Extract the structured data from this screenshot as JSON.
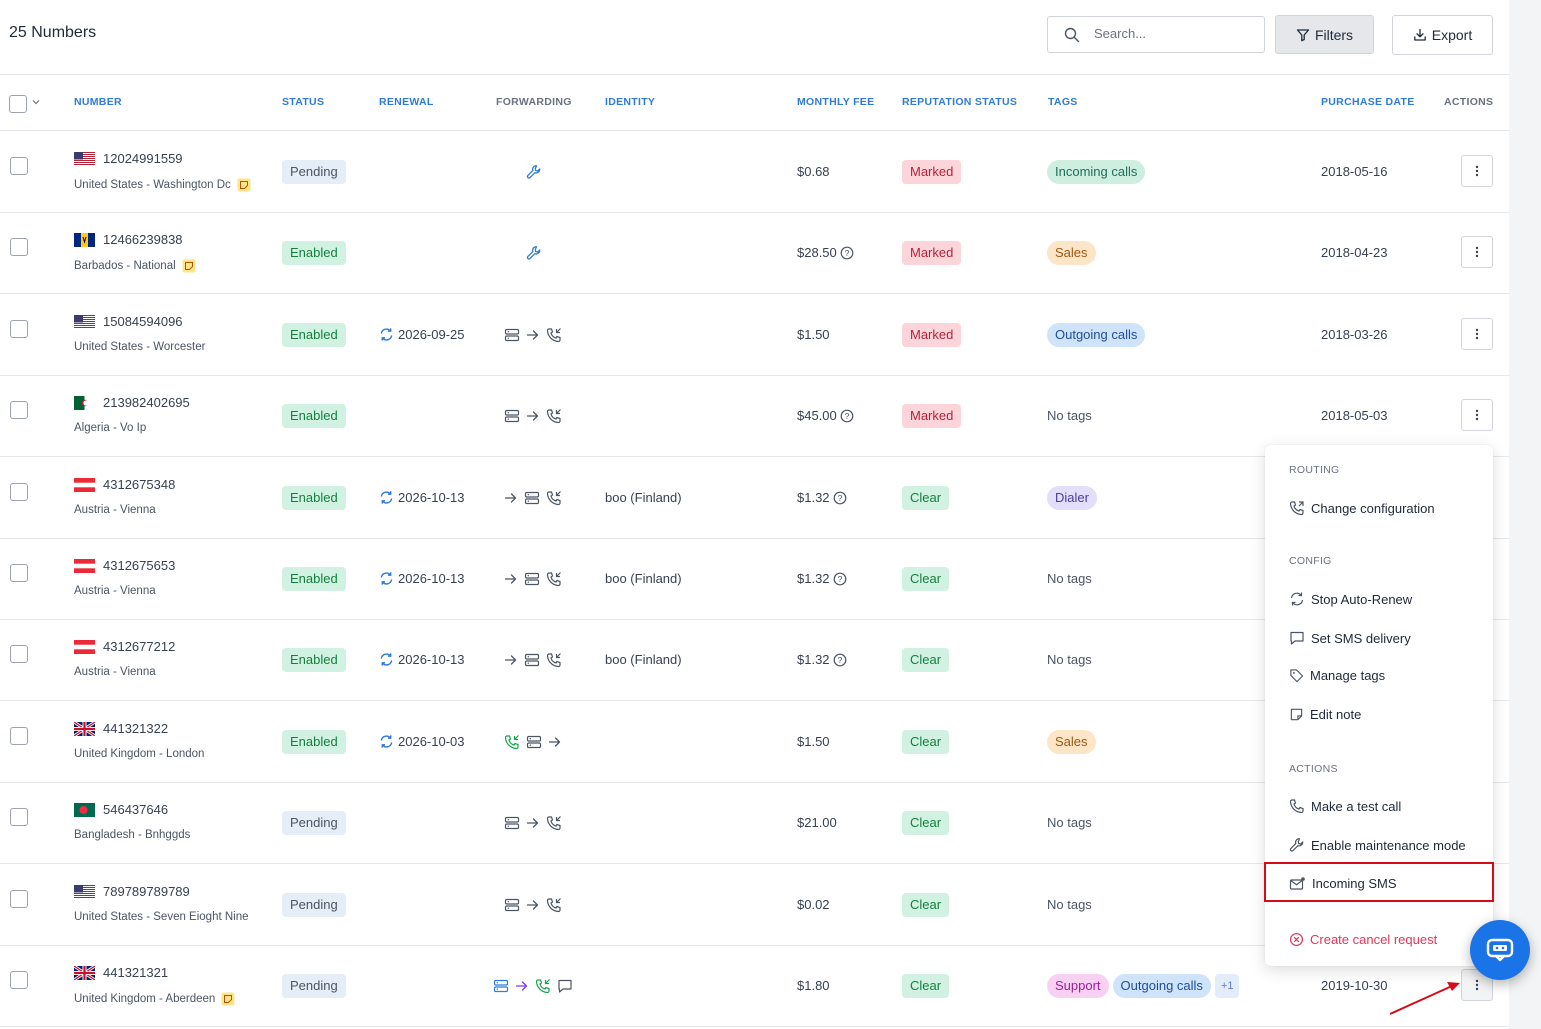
{
  "header": {
    "title": "25 Numbers",
    "search_placeholder": "Search...",
    "filters_label": "Filters",
    "export_label": "Export"
  },
  "columns": {
    "number": "NUMBER",
    "status": "STATUS",
    "renewal": "RENEWAL",
    "forwarding": "FORWARDING",
    "identity": "IDENTITY",
    "monthly_fee": "MONTHLY FEE",
    "reputation": "REPUTATION STATUS",
    "tags": "TAGS",
    "purchase_date": "PURCHASE DATE",
    "actions": "ACTIONS"
  },
  "rows": [
    {
      "flag": "us",
      "number": "12024991559",
      "location": "United States - Washington Dc",
      "note": true,
      "status": "Pending",
      "renewal": "",
      "forwarding": "maintenance",
      "identity": "",
      "fee": "$0.68",
      "fee_info": false,
      "reputation": "Marked",
      "tags": [
        "Incoming calls"
      ],
      "no_tags": "",
      "purchase_date": "2018-05-16"
    },
    {
      "flag": "bb",
      "number": "12466239838",
      "location": "Barbados - National",
      "note": true,
      "status": "Enabled",
      "renewal": "",
      "forwarding": "maintenance",
      "identity": "",
      "fee": "$28.50",
      "fee_info": true,
      "reputation": "Marked",
      "tags": [
        "Sales"
      ],
      "no_tags": "",
      "purchase_date": "2018-04-23"
    },
    {
      "flag": "us",
      "number": "15084594096",
      "location": "United States - Worcester",
      "note": false,
      "status": "Enabled",
      "renewal": "2026-09-25",
      "forwarding": "server-arrow-phone",
      "identity": "",
      "fee": "$1.50",
      "fee_info": false,
      "reputation": "Marked",
      "tags": [
        "Outgoing calls"
      ],
      "no_tags": "",
      "purchase_date": "2018-03-26"
    },
    {
      "flag": "dz",
      "number": "213982402695",
      "location": "Algeria - Vo Ip",
      "note": false,
      "status": "Enabled",
      "renewal": "",
      "forwarding": "server-arrow-phone",
      "identity": "",
      "fee": "$45.00",
      "fee_info": true,
      "reputation": "Marked",
      "tags": [],
      "no_tags": "No tags",
      "purchase_date": "2018-05-03"
    },
    {
      "flag": "at",
      "number": "4312675348",
      "location": "Austria - Vienna",
      "note": false,
      "status": "Enabled",
      "renewal": "2026-10-13",
      "forwarding": "arrow-server-phone",
      "identity": "boo (Finland)",
      "fee": "$1.32",
      "fee_info": true,
      "reputation": "Clear",
      "tags": [
        "Dialer"
      ],
      "no_tags": "",
      "purchase_date": ""
    },
    {
      "flag": "at",
      "number": "4312675653",
      "location": "Austria - Vienna",
      "note": false,
      "status": "Enabled",
      "renewal": "2026-10-13",
      "forwarding": "arrow-server-phone",
      "identity": "boo (Finland)",
      "fee": "$1.32",
      "fee_info": true,
      "reputation": "Clear",
      "tags": [],
      "no_tags": "No tags",
      "purchase_date": ""
    },
    {
      "flag": "at",
      "number": "4312677212",
      "location": "Austria - Vienna",
      "note": false,
      "status": "Enabled",
      "renewal": "2026-10-13",
      "forwarding": "arrow-server-phone",
      "identity": "boo (Finland)",
      "fee": "$1.32",
      "fee_info": true,
      "reputation": "Clear",
      "tags": [],
      "no_tags": "No tags",
      "purchase_date": ""
    },
    {
      "flag": "gb",
      "number": "441321322",
      "location": "United Kingdom - London",
      "note": false,
      "status": "Enabled",
      "renewal": "2026-10-03",
      "forwarding": "phone-server-arrow",
      "identity": "",
      "fee": "$1.50",
      "fee_info": false,
      "reputation": "Clear",
      "tags": [
        "Sales"
      ],
      "no_tags": "",
      "purchase_date": ""
    },
    {
      "flag": "bd",
      "number": "546437646",
      "location": "Bangladesh - Bnhggds",
      "note": false,
      "status": "Pending",
      "renewal": "",
      "forwarding": "server-arrow-phone",
      "identity": "",
      "fee": "$21.00",
      "fee_info": false,
      "reputation": "Clear",
      "tags": [],
      "no_tags": "No tags",
      "purchase_date": ""
    },
    {
      "flag": "us",
      "number": "789789789789",
      "location": "United States - Seven Eioght Nine",
      "note": false,
      "status": "Pending",
      "renewal": "",
      "forwarding": "server-arrow-phone",
      "identity": "",
      "fee": "$0.02",
      "fee_info": false,
      "reputation": "Clear",
      "tags": [],
      "no_tags": "No tags",
      "purchase_date": ""
    },
    {
      "flag": "gb",
      "number": "441321321",
      "location": "United Kingdom - Aberdeen",
      "note": true,
      "status": "Pending",
      "renewal": "",
      "forwarding": "server-arrow-phone-sms",
      "identity": "",
      "fee": "$1.80",
      "fee_info": false,
      "reputation": "Clear",
      "tags": [
        "Support",
        "Outgoing calls"
      ],
      "tags_more": "+1",
      "no_tags": "",
      "purchase_date": "2019-10-30"
    }
  ],
  "menu": {
    "routing_title": "ROUTING",
    "change_config": "Change configuration",
    "config_title": "CONFIG",
    "stop_auto_renew": "Stop Auto-Renew",
    "set_sms_delivery": "Set SMS delivery",
    "manage_tags": "Manage tags",
    "edit_note": "Edit note",
    "actions_title": "ACTIONS",
    "make_test_call": "Make a test call",
    "enable_maintenance": "Enable maintenance mode",
    "incoming_sms": "Incoming SMS",
    "create_cancel": "Create cancel request"
  },
  "colors": {
    "accent": "#2f7bd9",
    "highlight_box": "#d60b16",
    "annotation_arrow": "#d60b16",
    "chat_button": "#1a74e8"
  },
  "icons": {
    "search": "search-icon",
    "filter": "filter-icon",
    "download": "download-icon",
    "more": "more-vertical-icon",
    "chat": "chatbot-icon"
  }
}
